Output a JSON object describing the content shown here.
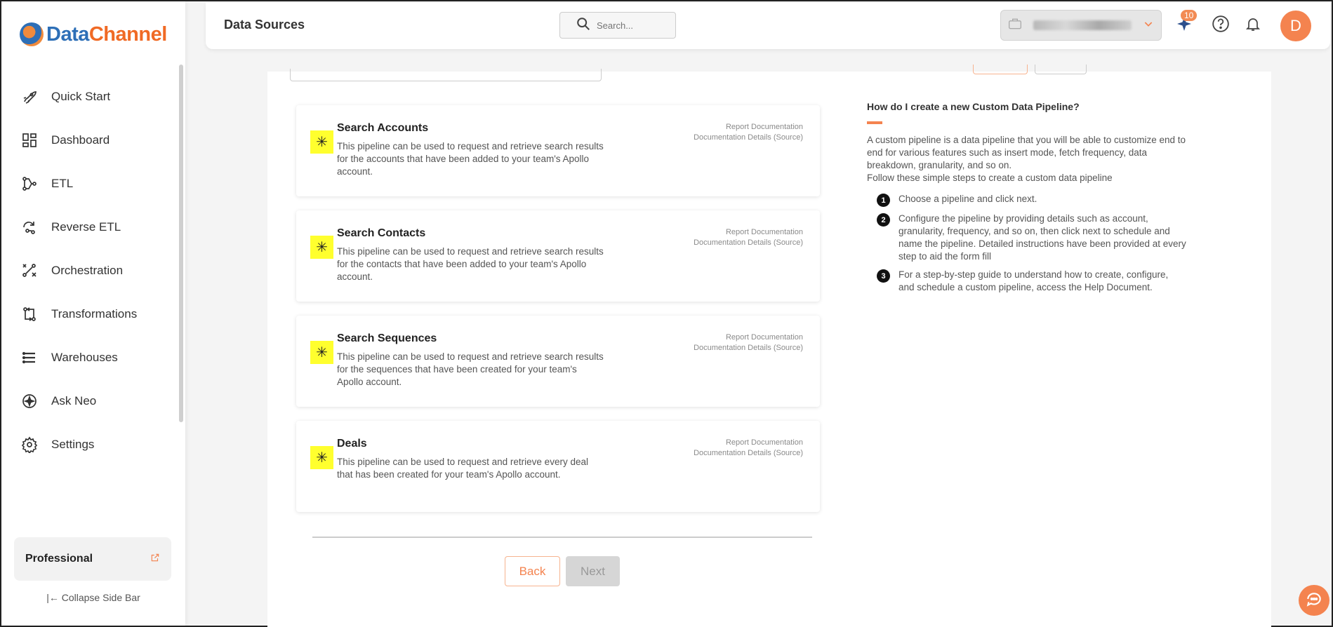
{
  "brand": {
    "part1": "Data",
    "part2": "Channel"
  },
  "sidebar": {
    "items": [
      {
        "label": "Quick Start",
        "icon": "rocket-icon"
      },
      {
        "label": "Dashboard",
        "icon": "grid-icon"
      },
      {
        "label": "ETL",
        "icon": "etl-flow-icon"
      },
      {
        "label": "Reverse ETL",
        "icon": "reverse-etl-icon"
      },
      {
        "label": "Orchestration",
        "icon": "orchestration-icon"
      },
      {
        "label": "Transformations",
        "icon": "transform-icon"
      },
      {
        "label": "Warehouses",
        "icon": "stack-icon"
      },
      {
        "label": "Ask Neo",
        "icon": "sparkle-icon"
      },
      {
        "label": "Settings",
        "icon": "gear-icon"
      }
    ],
    "plan_label": "Professional",
    "collapse_label": "Collapse Side Bar"
  },
  "header": {
    "title": "Data Sources",
    "search_placeholder": "Search...",
    "notification_badge": "10",
    "avatar_initial": "D"
  },
  "pipelines": [
    {
      "title": "Search Accounts",
      "description": "This pipeline can be used to request and retrieve search results for the accounts that have been added to your team's Apollo account.",
      "link1": "Report Documentation",
      "link2": "Documentation Details (Source)"
    },
    {
      "title": "Search Contacts",
      "description": "This pipeline can be used to request and retrieve search results for the contacts that have been added to your team's Apollo account.",
      "link1": "Report Documentation",
      "link2": "Documentation Details (Source)"
    },
    {
      "title": "Search Sequences",
      "description": "This pipeline can be used to request and retrieve search results for the sequences that have been created for your team's Apollo account.",
      "link1": "Report Documentation",
      "link2": "Documentation Details (Source)"
    },
    {
      "title": "Deals",
      "description": "This pipeline can be used to request and retrieve every deal that has been created for your team's Apollo account.",
      "link1": "Report Documentation",
      "link2": "Documentation Details (Source)"
    }
  ],
  "buttons": {
    "back": "Back",
    "next": "Next"
  },
  "help": {
    "title": "How do I create a new Custom Data Pipeline?",
    "paragraph": "A custom pipeline is a data pipeline that you will be able to customize end to end for various features such as insert mode, fetch frequency, data breakdown, granularity, and so on.",
    "intro": "Follow these simple steps to create a custom data pipeline",
    "steps": [
      {
        "num": "1",
        "text": "Choose a pipeline and click next."
      },
      {
        "num": "2",
        "text": "Configure the pipeline by providing details such as account, granularity, frequency, and so on, then click next to schedule and name the pipeline. Detailed instructions have been provided at every step to aid the form fill"
      },
      {
        "num": "3",
        "text": "For a step-by-step guide to understand how to create, configure, and schedule a custom pipeline, access the Help Document."
      }
    ]
  },
  "colors": {
    "accent": "#f4834f",
    "brand_blue": "#2d6fb7",
    "brand_orange": "#f06a25",
    "pipeline_icon_bg": "#ffff2e"
  }
}
